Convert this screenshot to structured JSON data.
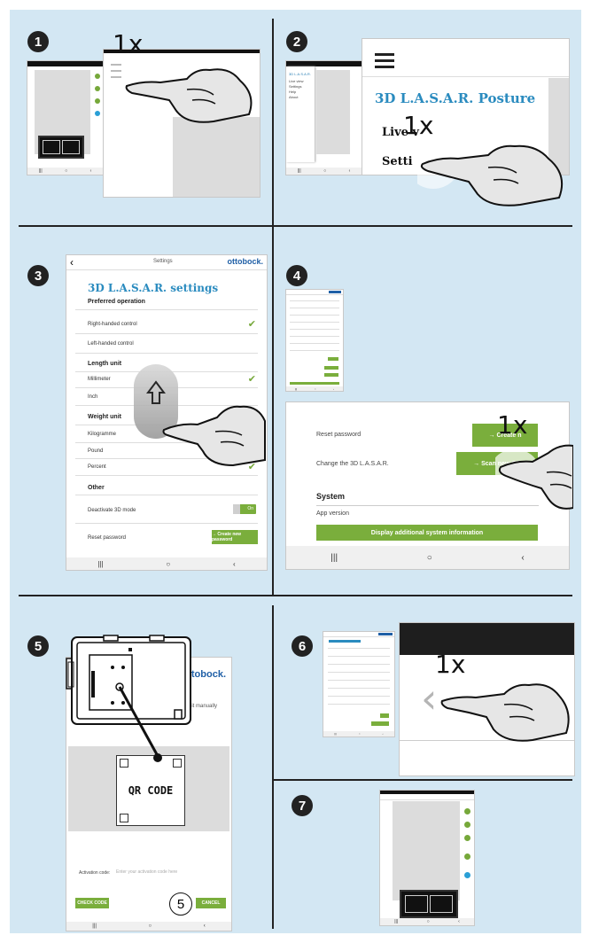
{
  "steps": [
    "1",
    "2",
    "3",
    "4",
    "5",
    "6",
    "7"
  ],
  "tap_label": "1x",
  "brand": "ottobock.",
  "step2": {
    "menu_title": "3D L.A.S.A.R. Posture",
    "item_live": "Live v",
    "item_settings": "Setti"
  },
  "step3": {
    "header": "Settings",
    "title": "3D L.A.S.A.R. settings",
    "sec_operation": "Preferred operation",
    "opt_right": "Right-handed control",
    "opt_left": "Left-handed control",
    "sec_length": "Length unit",
    "opt_mm": "Millimeter",
    "opt_inch": "Inch",
    "sec_weight": "Weight unit",
    "opt_kg": "Kilogramme",
    "opt_pound": "Pound",
    "opt_percent": "Percent",
    "sec_other": "Other",
    "opt_deactivate": "Deactivate 3D mode",
    "toggle_on": "On",
    "opt_reset": "Reset password",
    "btn_create": "→ Create new password"
  },
  "step4": {
    "reset_label": "Reset password",
    "btn_create": "→ Create n",
    "change_label": "Change the 3D L.A.S.A.R.",
    "btn_scan": "→ Scan new QR",
    "system_title": "System",
    "app_version": "App version",
    "btn_display": "Display additional system information"
  },
  "step5": {
    "manual_text": "enter it manually",
    "qr_label": "QR CODE",
    "activation_label": "Activation code:",
    "activation_placeholder": "Enter your activation code here",
    "btn_check": "CHECK CODE",
    "btn_cancel": "CANCEL"
  },
  "colors": {
    "background": "#d3e7f3",
    "accent_green": "#7aae3c",
    "title_blue": "#2a8bbf",
    "brand_blue": "#1f5fa6"
  }
}
